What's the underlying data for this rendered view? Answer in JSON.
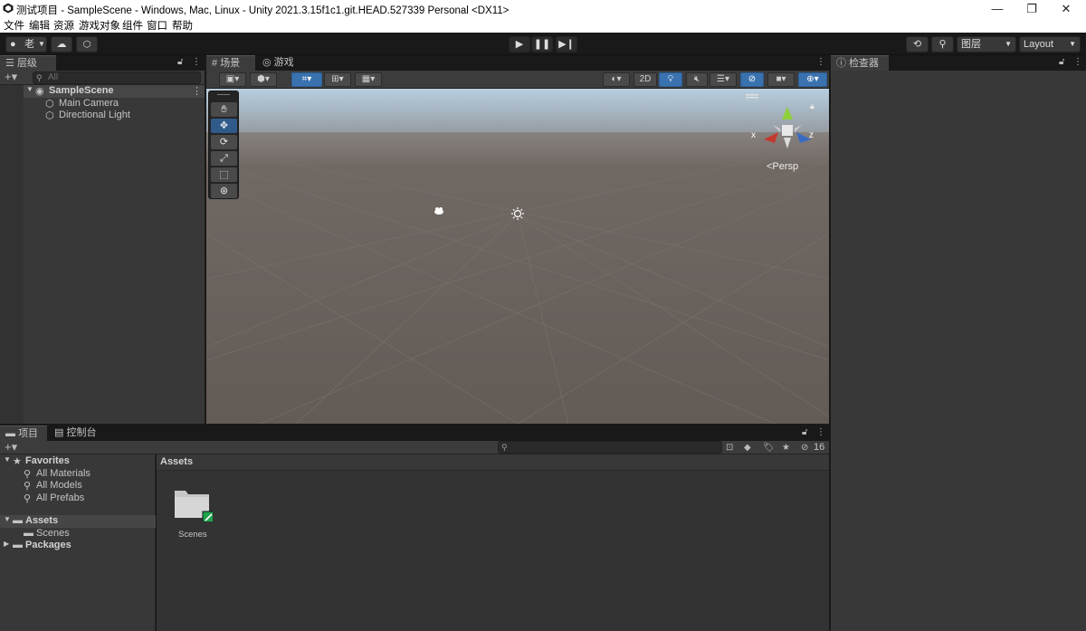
{
  "window": {
    "title": "测试项目 - SampleScene - Windows, Mac, Linux - Unity 2021.3.15f1c1.git.HEAD.527339 Personal <DX11>",
    "controls": {
      "minimize": "—",
      "restore": "❐",
      "close": "✕"
    }
  },
  "menu": [
    "文件",
    "编辑",
    "资源",
    "游戏对象",
    "组件",
    "窗口",
    "帮助"
  ],
  "toolbar": {
    "account_label": "老",
    "layers_label": "图层",
    "layout_label": "Layout"
  },
  "hierarchy": {
    "tab_label": "层级",
    "search_placeholder": "All",
    "scene_name": "SampleScene",
    "items": [
      "Main Camera",
      "Directional Light"
    ]
  },
  "scene_panel": {
    "tabs": [
      "场景",
      "游戏"
    ],
    "btn_2d": "2D",
    "persp_label": "<Persp",
    "axis_x": "x",
    "axis_z": "z"
  },
  "inspector": {
    "tab_label": "检查器"
  },
  "project": {
    "tabs": [
      "项目",
      "控制台"
    ],
    "favorites_label": "Favorites",
    "favorites_items": [
      "All Materials",
      "All Models",
      "All Prefabs"
    ],
    "assets_label": "Assets",
    "assets_children": [
      "Scenes"
    ],
    "packages_label": "Packages",
    "breadcrumb": "Assets",
    "folder_name": "Scenes",
    "hidden_count": "16"
  },
  "colors": {
    "accent_blue": "#3a72b0",
    "panel_bg": "#383838",
    "dark_bg": "#191919",
    "sky_top": "#b7cfe0",
    "ground": "#6b635f"
  }
}
